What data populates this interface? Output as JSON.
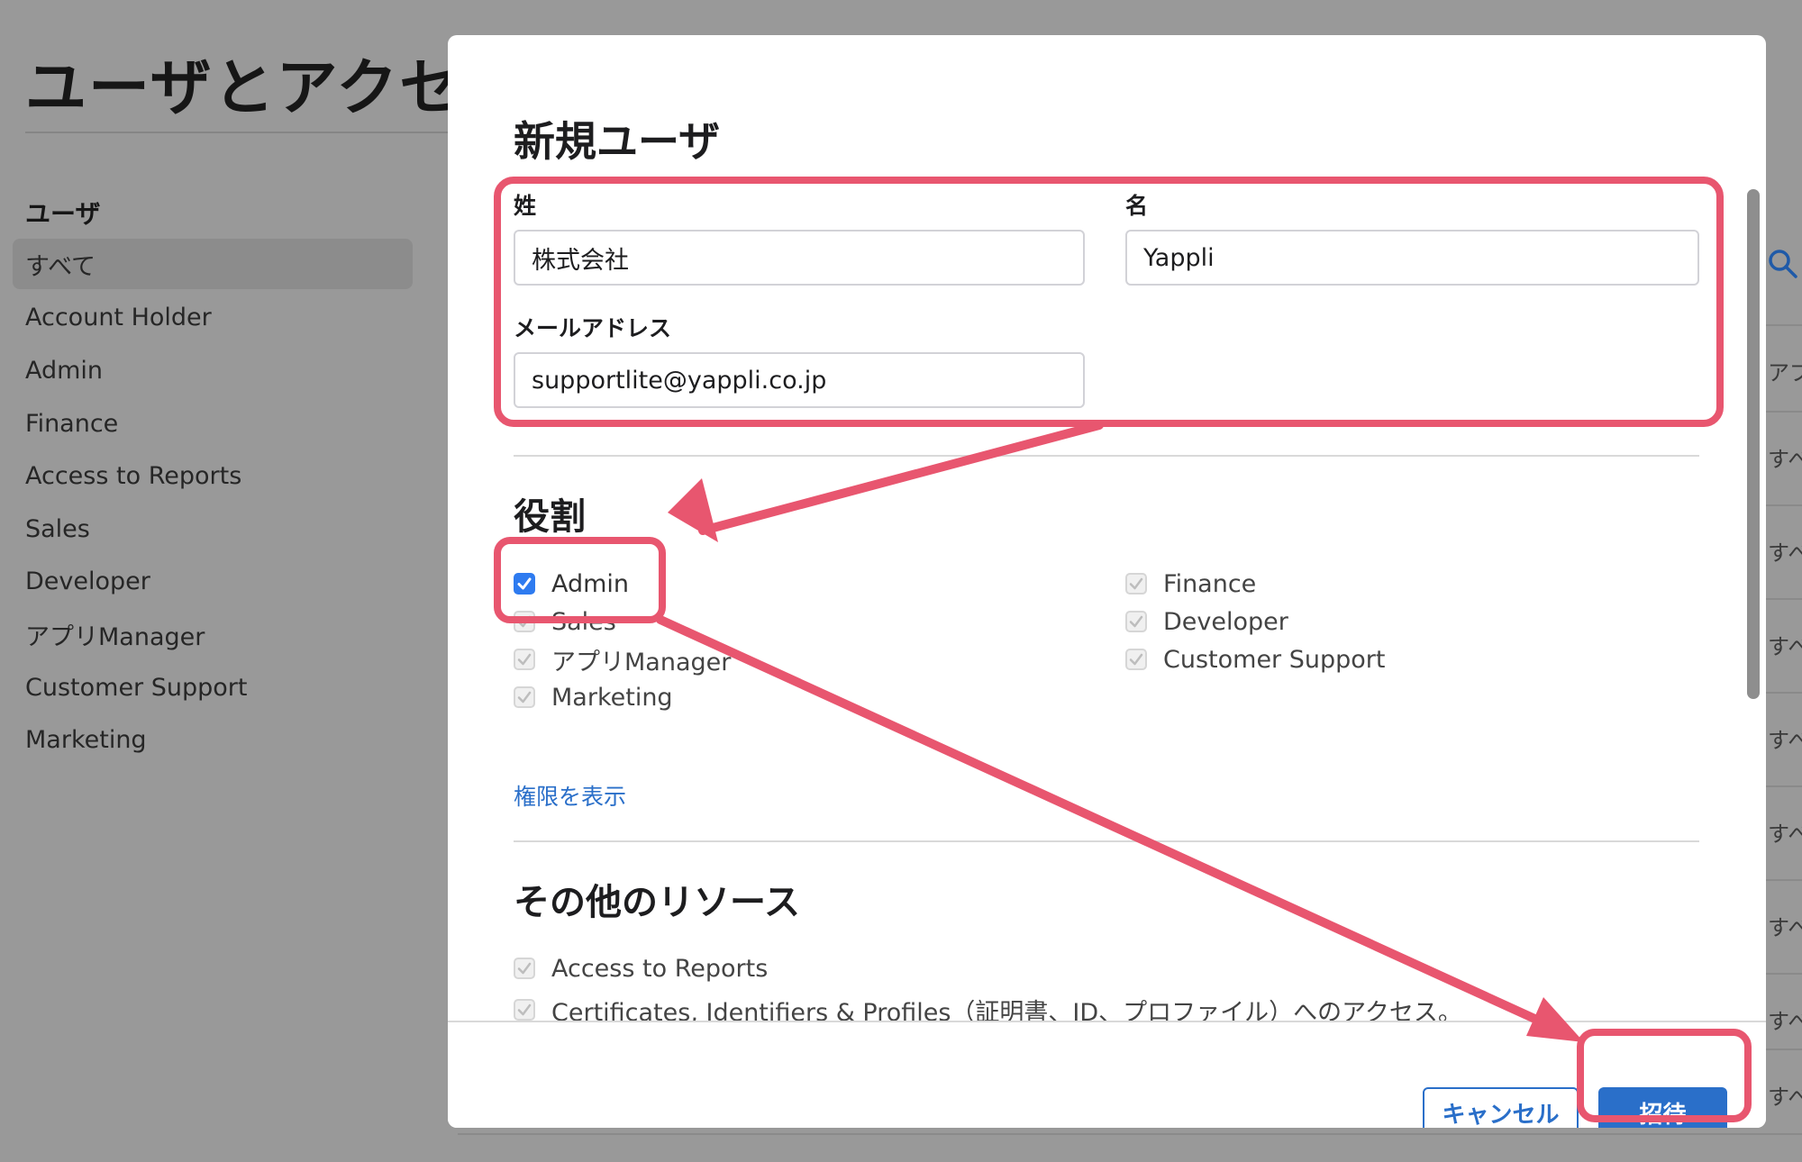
{
  "background": {
    "page_title": "ユーザとアクセ",
    "sidebar": {
      "heading": "ユーザ",
      "items": [
        {
          "label": "すべて",
          "active": true
        },
        {
          "label": "Account Holder"
        },
        {
          "label": "Admin"
        },
        {
          "label": "Finance"
        },
        {
          "label": "Access to Reports"
        },
        {
          "label": "Sales"
        },
        {
          "label": "Developer"
        },
        {
          "label": "アプリManager"
        },
        {
          "label": "Customer Support"
        },
        {
          "label": "Marketing"
        }
      ]
    },
    "right_column": {
      "search_icon": "search-icon",
      "row_labels": [
        "アプリ",
        "すべ",
        "すべ",
        "すべ",
        "すべ",
        "すべ",
        "すべ",
        "すべ",
        "すべ"
      ]
    }
  },
  "modal": {
    "title": "新規ユーザ",
    "last_name_label": "姓",
    "last_name_value": "株式会社",
    "first_name_label": "名",
    "first_name_value": "Yappli",
    "email_label": "メールアドレス",
    "email_value": "supportlite@yappli.co.jp",
    "roles_title": "役割",
    "roles_left": [
      {
        "label": "Admin",
        "checked": true
      },
      {
        "label": "Sales",
        "checked": false
      },
      {
        "label": "アプリManager",
        "checked": false
      },
      {
        "label": "Marketing",
        "checked": false
      }
    ],
    "roles_right": [
      {
        "label": "Finance",
        "checked": false
      },
      {
        "label": "Developer",
        "checked": false
      },
      {
        "label": "Customer Support",
        "checked": false
      }
    ],
    "permissions_link": "権限を表示",
    "other_resources_title": "その他のリソース",
    "other_resources": [
      {
        "label": "Access to Reports"
      },
      {
        "label": "Certificates, Identifiers & Profiles（証明書、ID、プロファイル）へのアクセス。"
      }
    ],
    "cancel_button": "キャンセル",
    "invite_button": "招待"
  },
  "colors": {
    "accent": "#2a6fc9",
    "checkbox_checked": "#2e7bf0",
    "annotation": "#e8566f",
    "overlay": "#999999"
  }
}
